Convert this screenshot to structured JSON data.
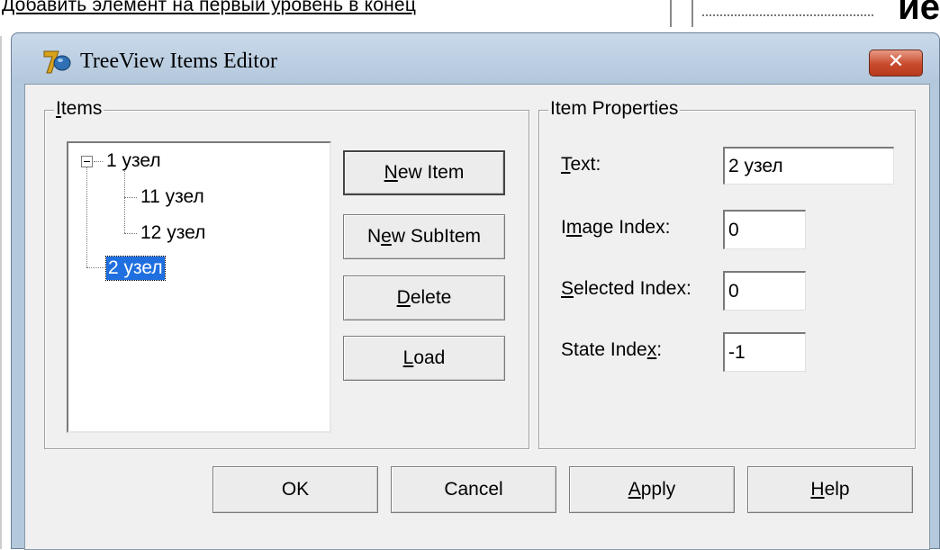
{
  "background": {
    "document_text": "Добавить элемент на первый уровень в конец",
    "corner_text": "ие"
  },
  "dialog": {
    "title": "TreeView Items Editor",
    "close_label": "✕",
    "items_group": {
      "legend": "Items",
      "tree": [
        {
          "label": "1 узел",
          "level": 0,
          "expanded": true,
          "selected": false
        },
        {
          "label": "11 узел",
          "level": 1,
          "selected": false
        },
        {
          "label": "12 узел",
          "level": 1,
          "selected": false
        },
        {
          "label": "2 узел",
          "level": 0,
          "selected": true
        }
      ],
      "buttons": {
        "new_item": "New Item",
        "new_subitem": "New SubItem",
        "delete": "Delete",
        "load": "Load"
      }
    },
    "properties_group": {
      "legend": "Item Properties",
      "text_label": "Text:",
      "text_value": "2 узел",
      "image_index_label": "Image Index:",
      "image_index_value": "0",
      "selected_index_label": "Selected Index:",
      "selected_index_value": "0",
      "state_index_label": "State Index:",
      "state_index_value": "-1"
    },
    "footer": {
      "ok": "OK",
      "cancel": "Cancel",
      "apply": "Apply",
      "help": "Help"
    }
  },
  "colors": {
    "frame": "#b5c9dd",
    "close_button": "#c84a2c",
    "selection": "#1f6fe0",
    "client": "#f0f0f0"
  },
  "icons": {
    "app": "delphi-helmet-icon",
    "close": "close-icon"
  }
}
